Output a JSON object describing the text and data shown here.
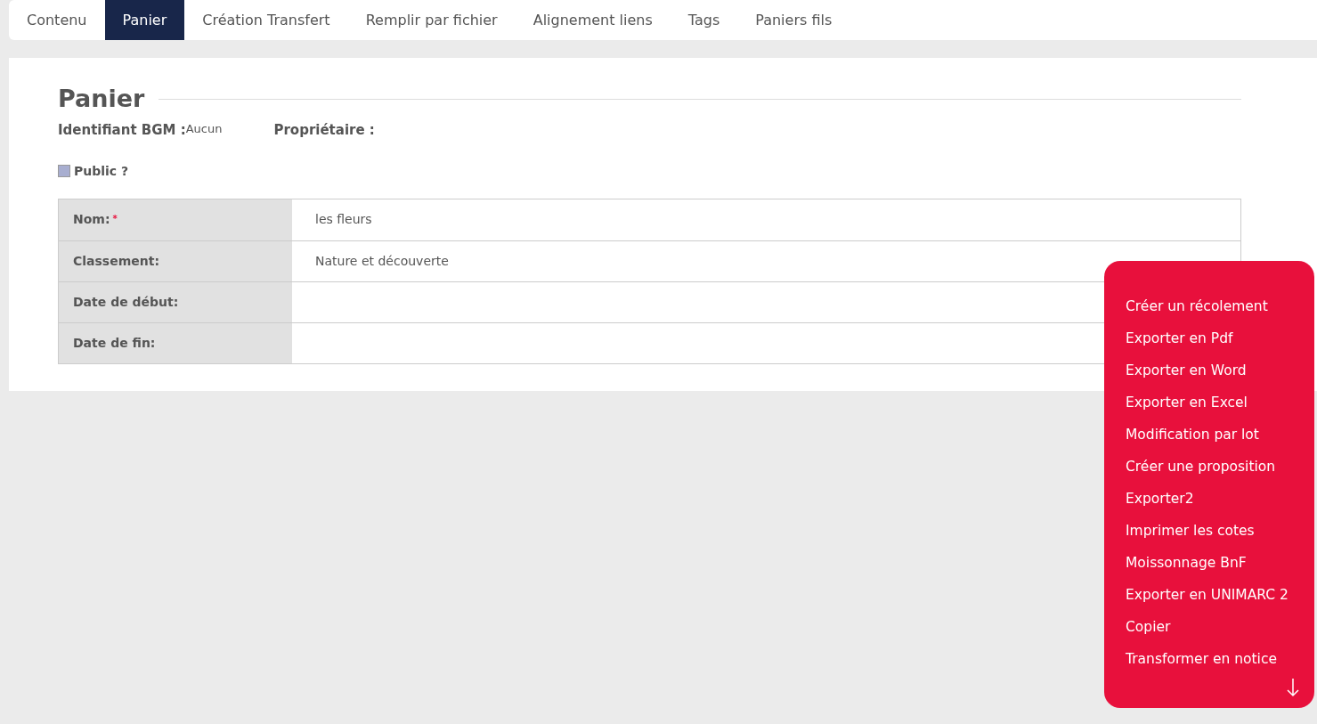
{
  "tabs": [
    {
      "label": "Contenu",
      "selected": false
    },
    {
      "label": "Panier",
      "selected": true
    },
    {
      "label": "Création Transfert",
      "selected": false
    },
    {
      "label": "Remplir par fichier",
      "selected": false
    },
    {
      "label": "Alignement liens",
      "selected": false
    },
    {
      "label": "Tags",
      "selected": false
    },
    {
      "label": "Paniers fils",
      "selected": false
    }
  ],
  "panel": {
    "title": "Panier",
    "identifier": {
      "label": "Identifiant BGM :",
      "value": "Aucun"
    },
    "owner": {
      "label": "Propriétaire :"
    },
    "public": {
      "label": "Public ?",
      "checked": false
    },
    "fields": [
      {
        "label": "Nom:",
        "required_mark": "*",
        "value": "les fleurs"
      },
      {
        "label": "Classement:",
        "value": "Nature et découverte"
      },
      {
        "label": "Date de début:"
      },
      {
        "label": "Date de fin:"
      }
    ]
  },
  "actions_menu": {
    "items": [
      "Créer un récolement",
      "Exporter en Pdf",
      "Exporter en Word",
      "Exporter en Excel",
      "Modification par lot",
      "Créer une proposition",
      "Exporter2",
      "Imprimer les cotes",
      "Moissonnage BnF",
      "Exporter en UNIMARC 2",
      "Copier",
      "Transformer en notice"
    ]
  }
}
